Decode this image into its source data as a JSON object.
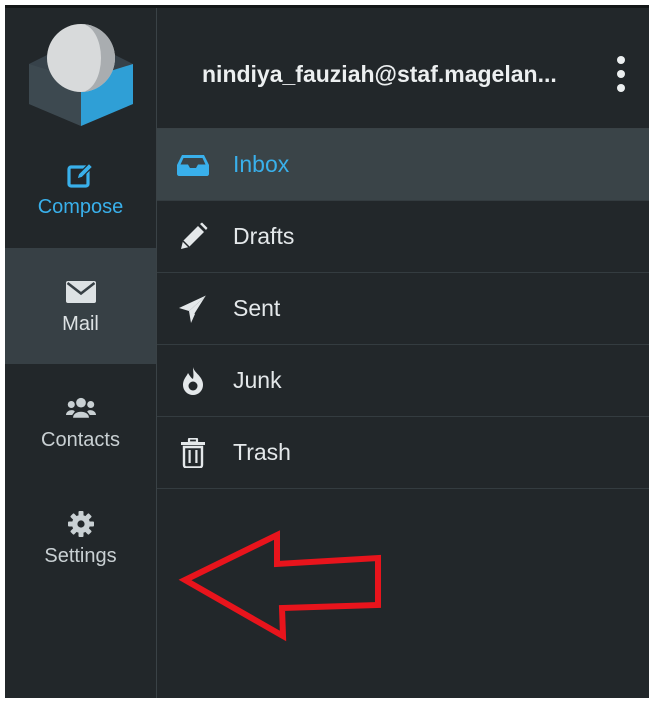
{
  "colors": {
    "accent": "#39b0eb",
    "background": "#22272a",
    "selected_nav": "#374045",
    "selected_folder": "#3a4448",
    "annotation_arrow": "#e8141c"
  },
  "nav": {
    "compose": {
      "label": "Compose",
      "icon": "compose-icon"
    },
    "mail": {
      "label": "Mail",
      "icon": "envelope-icon"
    },
    "contacts": {
      "label": "Contacts",
      "icon": "users-icon"
    },
    "settings": {
      "label": "Settings",
      "icon": "gear-icon"
    }
  },
  "header": {
    "account": "nindiya_fauziah@staf.magelan...",
    "menu_icon": "kebab-menu-icon"
  },
  "folders": [
    {
      "label": "Inbox",
      "icon": "inbox-icon",
      "active": true
    },
    {
      "label": "Drafts",
      "icon": "pencil-icon",
      "active": false
    },
    {
      "label": "Sent",
      "icon": "paper-plane-icon",
      "active": false
    },
    {
      "label": "Junk",
      "icon": "fire-icon",
      "active": false
    },
    {
      "label": "Trash",
      "icon": "trash-icon",
      "active": false
    }
  ],
  "annotation": {
    "icon": "left-arrow-annotation"
  }
}
